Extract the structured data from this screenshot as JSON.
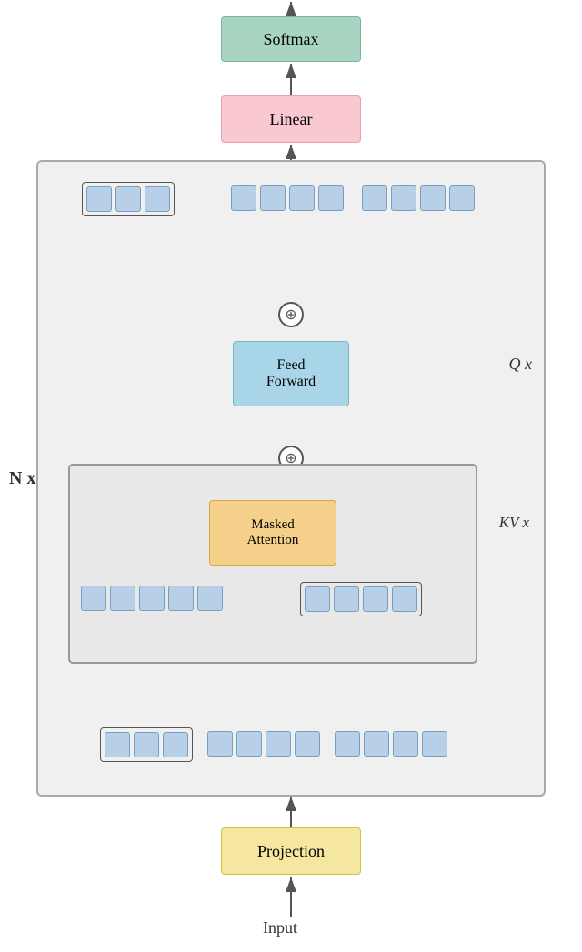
{
  "boxes": {
    "softmax": {
      "label": "Softmax",
      "bg": "#a8d5c2",
      "border": "#7ab5a0"
    },
    "linear": {
      "label": "Linear",
      "bg": "#f9c8d0",
      "border": "#e8a0aa"
    },
    "feedforward": {
      "label": "Feed\nForward",
      "bg": "#a8d5e8",
      "border": "#7ab5cc"
    },
    "masked": {
      "label": "Masked\nAttention",
      "bg": "#f5d08a",
      "border": "#d4a840"
    },
    "projection": {
      "label": "Projection",
      "bg": "#f5e6a0",
      "border": "#d4c040"
    }
  },
  "labels": {
    "nx": "N x",
    "qx": "Q x",
    "kvx": "KV x",
    "input": "Input",
    "add": "⊕"
  },
  "tokens": {
    "count": 4,
    "color": "#b8cfe8",
    "border": "#7a9ec0"
  }
}
